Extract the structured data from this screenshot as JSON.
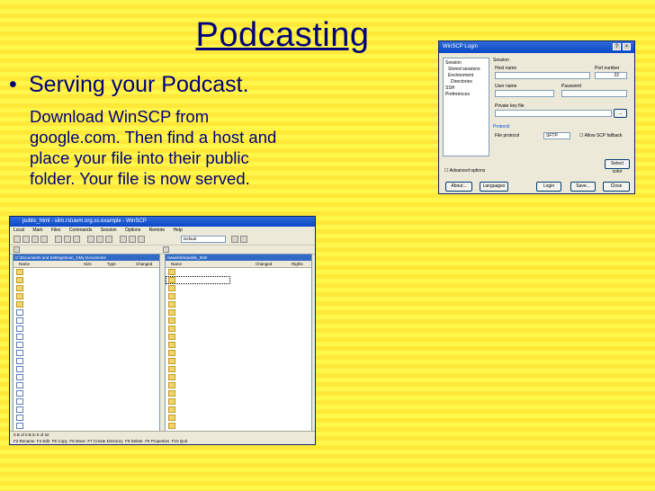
{
  "slide": {
    "title": "Podcasting",
    "bullet": "Serving your Podcast.",
    "body": "Download WinSCP from google.com. Then find a host and place your file into their public folder. Your file is now served."
  },
  "login_dialog": {
    "title": "WinSCP Login",
    "tree": [
      "Session",
      "Stored sessions",
      "Environment",
      "Directories",
      "SSH",
      "Preferences"
    ],
    "fields": {
      "host_label": "Host name",
      "port_label": "Port number",
      "port_value": "22",
      "user_label": "User name",
      "password_label": "Password",
      "key_label": "Private key file",
      "protocol_label": "Protocol",
      "file_protocol_label": "File protocol",
      "file_protocol_value": "SFTP",
      "fallback_label": "Allow SCP fallback"
    },
    "buttons": {
      "select_color": "Select color",
      "about": "About...",
      "languages": "Languages",
      "login": "Login",
      "save": "Save...",
      "close": "Close",
      "advanced": "Advanced options"
    }
  },
  "main_window": {
    "title": "public_html - slim.rstuwm.org.ss.example - WinSCP",
    "menu": [
      "Local",
      "Mark",
      "Files",
      "Commands",
      "Session",
      "Options",
      "Remote",
      "Help"
    ],
    "address": "Default",
    "left_path": "C:\\Documents and Settings\\tcan_1\\My Documents",
    "right_path": "/www/slim/public_html",
    "left_headers": [
      "Name",
      "Size",
      "Type",
      "Changed"
    ],
    "right_headers": [
      "Name",
      "Changed",
      "Rights"
    ],
    "status": "0 B of 0 B in 0 of 32",
    "commands": [
      "F2 Rename",
      "F4 Edit",
      "F5 Copy",
      "F6 Move",
      "F7 Create Directory",
      "F8 Delete",
      "F9 Properties",
      "F10 Quit"
    ]
  },
  "colors": {
    "text": "#00007a",
    "stripe_a": "#fff74a",
    "stripe_b": "#ffe83a",
    "xp_blue": "#0a48c8"
  }
}
